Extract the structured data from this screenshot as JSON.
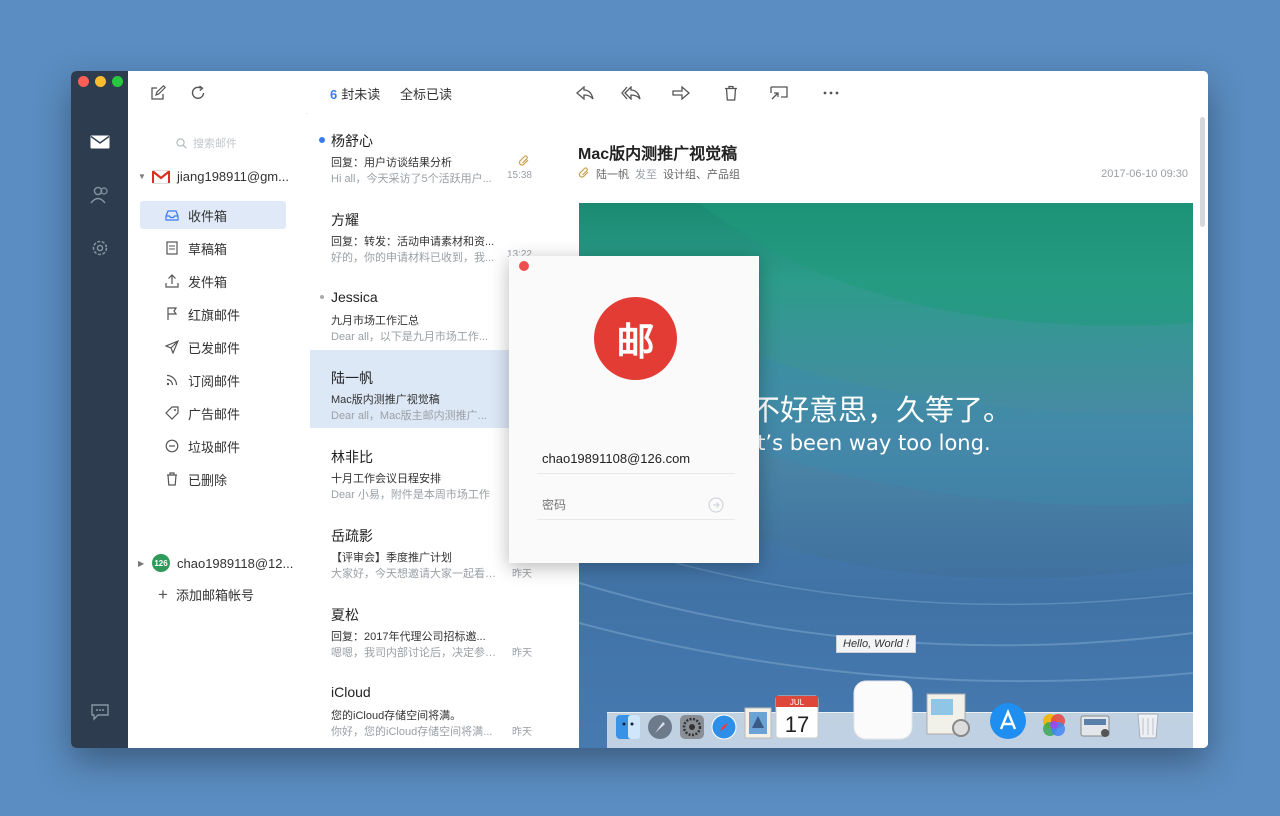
{
  "toolbar": {
    "compose_icon": "compose-icon",
    "refresh_icon": "refresh-icon",
    "unread_count": "6",
    "unread_label": "封未读",
    "mark_all_read": "全标已读",
    "actions": [
      "reply-icon",
      "reply-all-icon",
      "forward-icon",
      "trash-icon",
      "move-icon",
      "more-icon"
    ]
  },
  "rail": {
    "icons": [
      "mail-icon",
      "contacts-icon",
      "settings-icon",
      "feedback-icon"
    ]
  },
  "sidebar": {
    "search_placeholder": "搜索邮件",
    "accounts": [
      {
        "name": "jiang198911@gm...",
        "badge": "M"
      },
      {
        "name": "chao1989118@12...",
        "badge": "126"
      }
    ],
    "folders": [
      {
        "label": "收件箱",
        "icon": "inbox-icon"
      },
      {
        "label": "草稿箱",
        "icon": "draft-icon"
      },
      {
        "label": "发件箱",
        "icon": "outbox-icon"
      },
      {
        "label": "红旗邮件",
        "icon": "flag-icon"
      },
      {
        "label": "已发邮件",
        "icon": "sent-icon"
      },
      {
        "label": "订阅邮件",
        "icon": "rss-icon"
      },
      {
        "label": "广告邮件",
        "icon": "tag-icon"
      },
      {
        "label": "垃圾邮件",
        "icon": "spam-icon"
      },
      {
        "label": "已删除",
        "icon": "trash-icon"
      }
    ],
    "add_account": "添加邮箱帐号"
  },
  "messages": [
    {
      "sender": "杨舒心",
      "subject": "回复：用户访谈结果分析",
      "preview": "Hi all，今天采访了5个活跃用户...",
      "time": "15:38"
    },
    {
      "sender": "方耀",
      "subject": "回复：转发：活动申请素材和资...",
      "preview": "好的，你的申请材料已收到，我...",
      "time": "13:22"
    },
    {
      "sender": "Jessica",
      "subject": "九月市场工作汇总",
      "preview": "Dear all，以下是九月市场工作...",
      "time": "10"
    },
    {
      "sender": "陆一帆",
      "subject": "Mac版内测推广视觉稿",
      "preview": "Dear all，Mac版主邮内测推广...",
      "time": "@"
    },
    {
      "sender": "林非比",
      "subject": "十月工作会议日程安排",
      "preview": "Dear 小易，附件是本周市场工作",
      "time": ""
    },
    {
      "sender": "岳疏影",
      "subject": "【评审会】季度推广计划",
      "preview": "大家好，今天想邀请大家一起看一...",
      "time": "昨天"
    },
    {
      "sender": "夏松",
      "subject": "回复：2017年代理公司招标邀...",
      "preview": "嗯嗯，我司内部讨论后，决定参加...",
      "time": "昨天"
    },
    {
      "sender": "iCloud",
      "subject": "您的iCloud存储空间将满。",
      "preview": "你好，您的iCloud存储空间将满...",
      "time": "昨天"
    }
  ],
  "reading": {
    "title": "Mac版内测推广视觉稿",
    "from": "陆一帆",
    "sent_label": "发至",
    "recipients": "设计组、产品组",
    "date": "2017-06-10  09:30",
    "wallpaper_line1": "不好意思，久等了。",
    "wallpaper_line2": "It’s been way too long.",
    "tooltip": "Hello, World !",
    "dock_icons": [
      "finder-icon",
      "launchpad-icon",
      "preferences-icon",
      "safari-icon",
      "mail-stamp-icon",
      "calendar-icon",
      "blank-app-icon",
      "preview-icon",
      "app-store-icon",
      "photos-icon",
      "scanner-icon",
      "trash-icon"
    ],
    "calendar_month": "JUL",
    "calendar_day": "17"
  },
  "login": {
    "logo_text": "邮",
    "email": "chao19891108@126.com",
    "password_placeholder": "密码"
  },
  "colors": {
    "desktop": "#5b8dc2",
    "rail": "#2d3d4f",
    "accent": "#3b7bf0",
    "selected_row": "#dde8f6",
    "logo": "#e23c34"
  }
}
